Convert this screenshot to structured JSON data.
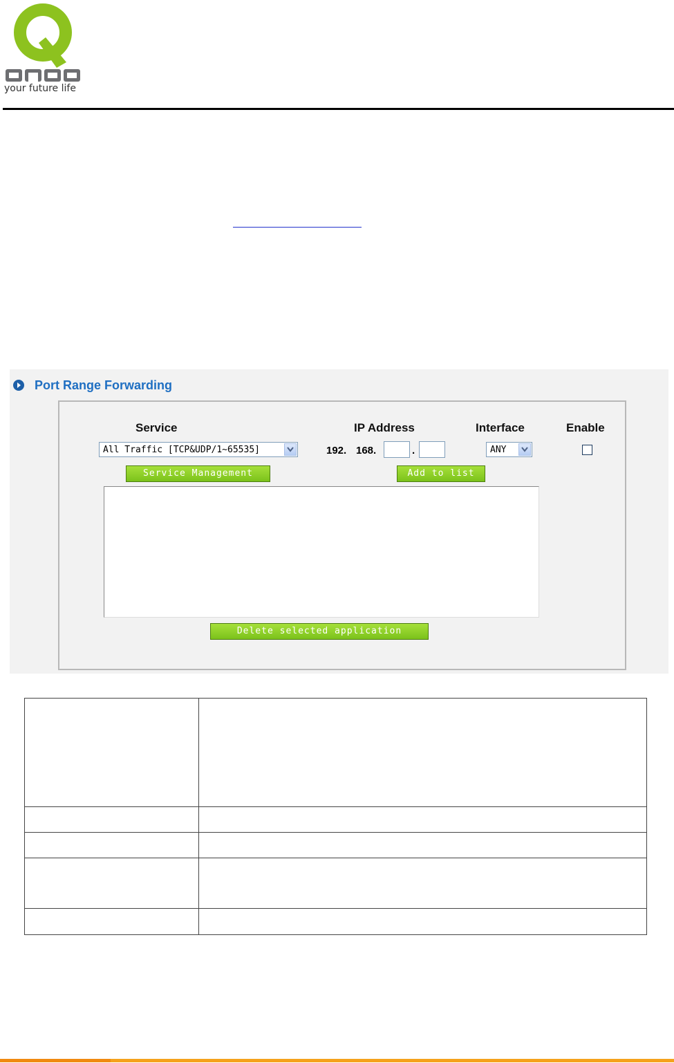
{
  "brand": {
    "tagline": "your future life",
    "colors": {
      "logo_green": "#8dc21f",
      "logo_gray": "#6d6e71",
      "accent_orange": "#f5a21c"
    }
  },
  "port_range_forwarding": {
    "title": "Port Range Forwarding",
    "headers": {
      "service": "Service",
      "ip_address": "IP Address",
      "interface": "Interface",
      "enable": "Enable"
    },
    "service_select_value": "All Traffic [TCP&UDP/1~65535]",
    "ip_prefix_a": "192.",
    "ip_prefix_b": "168.",
    "ip_dot": ".",
    "interface_select_value": "ANY",
    "enable_checked": false,
    "buttons": {
      "service_management": "Service Management",
      "add_to_list": "Add to list",
      "delete_selected": "Delete selected application"
    },
    "list_items": []
  }
}
